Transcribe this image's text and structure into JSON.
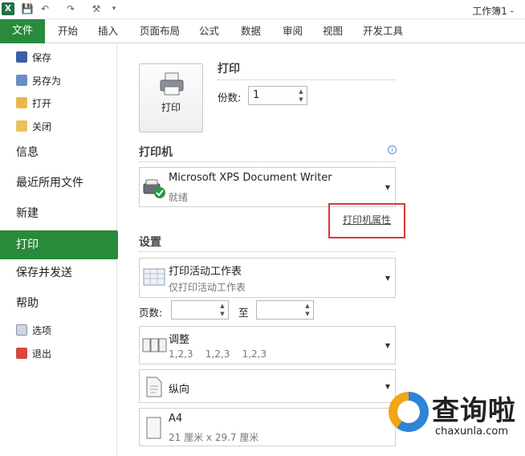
{
  "window": {
    "title": "工作簿1 -"
  },
  "ribbon": {
    "file_tab": "文件",
    "tabs": [
      "开始",
      "插入",
      "页面布局",
      "公式",
      "数据",
      "审阅",
      "视图",
      "开发工具"
    ]
  },
  "nav": {
    "save": "保存",
    "save_as": "另存为",
    "open": "打开",
    "close": "关闭",
    "info": "信息",
    "recent": "最近所用文件",
    "new": "新建",
    "print": "打印",
    "save_send": "保存并发送",
    "help": "帮助",
    "options": "选项",
    "exit": "退出"
  },
  "print": {
    "title": "打印",
    "button_label": "打印",
    "copies_label": "份数:",
    "copies_value": "1"
  },
  "printer": {
    "section_title": "打印机",
    "name": "Microsoft XPS Document Writer",
    "status": "就绪",
    "properties_link": "打印机属性"
  },
  "settings": {
    "section_title": "设置",
    "scope_main": "打印活动工作表",
    "scope_sub": "仅打印活动工作表",
    "pages_label": "页数:",
    "to_label": "至",
    "collate_main": "调整",
    "collate_sub": "1,2,3    1,2,3    1,2,3",
    "orientation": "纵向",
    "paper_main": "A4",
    "paper_sub": "21 厘米 x 29.7 厘米"
  },
  "watermark": {
    "cn": "查询啦",
    "en": "chaxunla.com"
  },
  "colors": {
    "accent": "#2a8a3c",
    "highlight_box": "#d8383b"
  }
}
